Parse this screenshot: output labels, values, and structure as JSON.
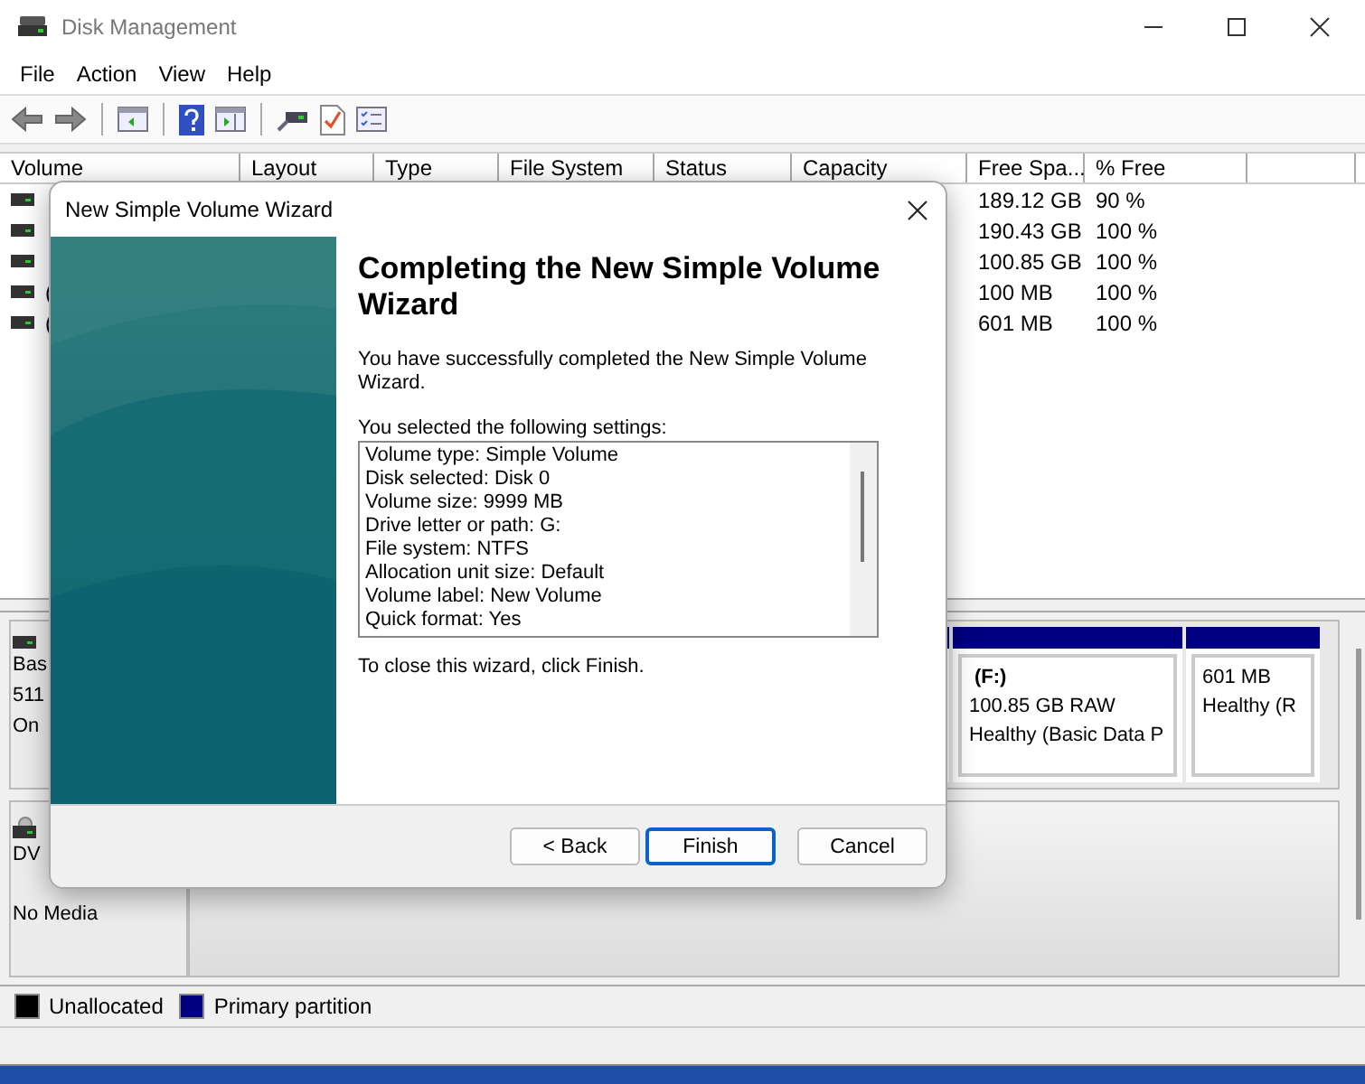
{
  "window": {
    "title": "Disk Management"
  },
  "menu": [
    "File",
    "Action",
    "View",
    "Help"
  ],
  "volume_list": {
    "columns": [
      "Volume",
      "Layout",
      "Type",
      "File System",
      "Status",
      "Capacity",
      "Free Spa...",
      "% Free"
    ],
    "rows": [
      {
        "free_space": "189.12 GB",
        "percent_free": "90 %"
      },
      {
        "free_space": "190.43 GB",
        "percent_free": "100 %"
      },
      {
        "free_space": "100.85 GB",
        "percent_free": "100 %"
      },
      {
        "volume": "(",
        "free_space": "100 MB",
        "percent_free": "100 %"
      },
      {
        "volume": "(",
        "free_space": "601 MB",
        "percent_free": "100 %"
      }
    ]
  },
  "disks": [
    {
      "kind": "disk",
      "lines": [
        "Bas",
        "511",
        "On"
      ],
      "partitions": [
        {
          "lines": [
            "(F:)",
            "100.85 GB RAW",
            "Healthy (Basic Data P"
          ]
        },
        {
          "lines": [
            "601 MB",
            "Healthy (R"
          ]
        }
      ]
    },
    {
      "kind": "cdrom",
      "name": "DV",
      "status": "No Media"
    }
  ],
  "legend": [
    {
      "label": "Unallocated",
      "color": "#000000"
    },
    {
      "label": "Primary partition",
      "color": "#000080"
    }
  ],
  "dialog": {
    "title": "New Simple Volume Wizard",
    "heading": "Completing the New Simple Volume Wizard",
    "intro": "You have successfully completed the New Simple Volume Wizard.",
    "settings_label": "You selected the following settings:",
    "settings": [
      "Volume type: Simple Volume",
      "Disk selected: Disk 0",
      "Volume size: 9999 MB",
      "Drive letter or path: G:",
      "File system: NTFS",
      "Allocation unit size: Default",
      "Volume label: New Volume",
      "Quick format: Yes"
    ],
    "close_hint": "To close this wizard, click Finish.",
    "buttons": [
      {
        "label": "< Back",
        "selected": false
      },
      {
        "label": "Finish",
        "selected": true
      },
      {
        "label": "Cancel",
        "selected": false
      }
    ]
  }
}
